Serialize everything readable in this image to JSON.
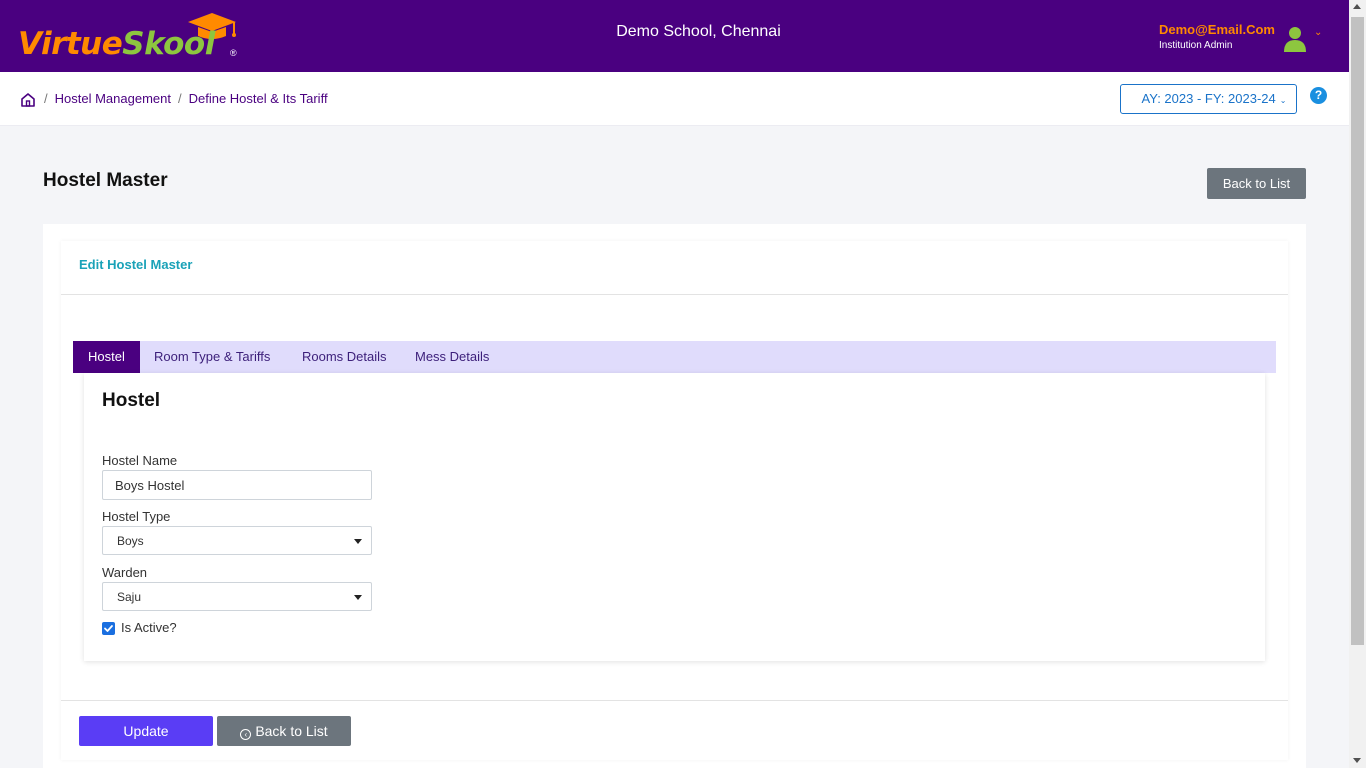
{
  "header": {
    "logo_part1": "Virtue",
    "logo_part2": "Skool",
    "logo_reg": "®",
    "school_name": "Demo School, Chennai",
    "user_email": "Demo@Email.Com",
    "user_role": "Institution Admin",
    "caret": "⌄"
  },
  "breadcrumb": {
    "items": [
      "Hostel Management",
      "Define Hostel & Its Tariff"
    ],
    "separator": "/"
  },
  "year_selector": {
    "label": "AY: 2023 - FY: 2023-24",
    "caret": "⌄"
  },
  "help": {
    "label": "?"
  },
  "page": {
    "title": "Hostel Master",
    "back_label": "Back to List"
  },
  "card": {
    "title": "Edit Hostel Master"
  },
  "tabs": [
    {
      "label": "Hostel",
      "active": true
    },
    {
      "label": "Room Type & Tariffs",
      "active": false
    },
    {
      "label": "Rooms Details",
      "active": false
    },
    {
      "label": "Mess Details",
      "active": false
    }
  ],
  "form": {
    "section_title": "Hostel",
    "hostel_name_label": "Hostel Name",
    "hostel_name_value": "Boys Hostel",
    "hostel_type_label": "Hostel Type",
    "hostel_type_value": "Boys",
    "warden_label": "Warden",
    "warden_value": "Saju",
    "is_active_label": "Is Active?",
    "is_active": true
  },
  "actions": {
    "update_label": "Update",
    "back_label": "Back to List"
  },
  "colors": {
    "header_bg": "#4a0080",
    "accent_orange": "#ff8a00",
    "accent_green": "#8dc63f",
    "tab_bar_bg": "#e0dcfc",
    "card_title": "#1aa2b8",
    "update_button": "#5a3df5",
    "secondary_button": "#6c757d"
  },
  "icons": [
    "graduation-cap-icon",
    "user-avatar-icon",
    "home-icon",
    "help-icon",
    "dropdown-caret-icon",
    "checkbox-check-icon",
    "back-circle-icon"
  ]
}
